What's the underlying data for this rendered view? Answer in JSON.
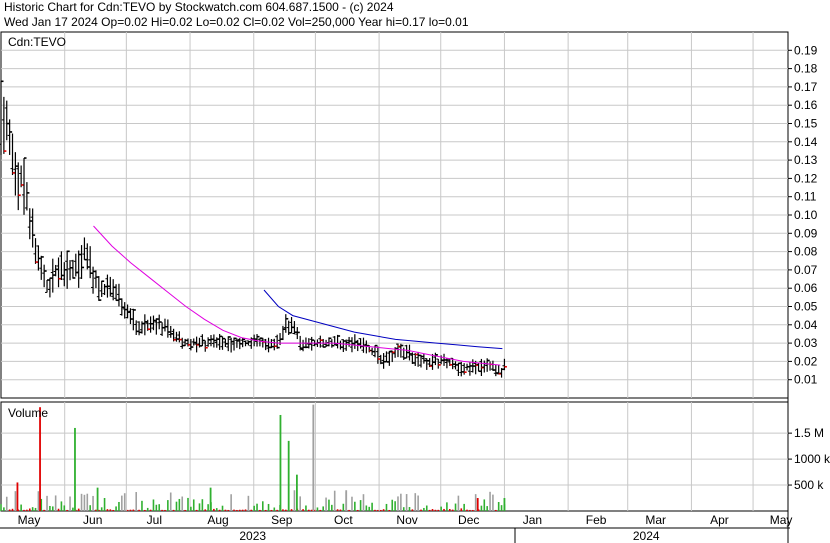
{
  "header": {
    "line1": "Historic Chart for Cdn:TEVO by Stockwatch.com 604.687.1500 - (c) 2024",
    "line2": "Wed Jan 17 2024   Op=0.02  Hi=0.02  Lo=0.02  Cl=0.02  Vol=250,000  Year hi=0.17  lo=0.01"
  },
  "chart_data": {
    "type": "line",
    "symbol_label": "Cdn:TEVO",
    "volume_label": "Volume",
    "price_axis": {
      "range": [
        0,
        0.2
      ],
      "ticks": [
        "0.19",
        "0.18",
        "0.17",
        "0.16",
        "0.15",
        "0.14",
        "0.13",
        "0.12",
        "0.11",
        "0.10",
        "0.09",
        "0.08",
        "0.07",
        "0.06",
        "0.05",
        "0.04",
        "0.03",
        "0.02",
        "0.01"
      ]
    },
    "volume_axis": {
      "range": [
        0,
        2100000
      ],
      "ticks": [
        {
          "label": "1.5 M",
          "value": 1500000
        },
        {
          "label": "1000 k",
          "value": 1000000
        },
        {
          "label": "500 k",
          "value": 500000
        }
      ]
    },
    "x_axis": {
      "range_days": [
        0,
        383
      ],
      "months": [
        {
          "label": "May",
          "day": 0
        },
        {
          "label": "Jun",
          "day": 31
        },
        {
          "label": "Jul",
          "day": 61
        },
        {
          "label": "Aug",
          "day": 92
        },
        {
          "label": "Sep",
          "day": 123
        },
        {
          "label": "Oct",
          "day": 153
        },
        {
          "label": "Nov",
          "day": 184
        },
        {
          "label": "Dec",
          "day": 214
        },
        {
          "label": "Jan",
          "day": 245
        },
        {
          "label": "Feb",
          "day": 276
        },
        {
          "label": "Mar",
          "day": 305
        },
        {
          "label": "Apr",
          "day": 336
        },
        {
          "label": "May",
          "day": 366
        }
      ],
      "years": [
        {
          "label": "2023",
          "from": 0,
          "to": 245
        },
        {
          "label": "2024",
          "from": 245,
          "to": 383
        }
      ]
    },
    "ohlc_anchors": [
      [
        0,
        0.15
      ],
      [
        2,
        0.16
      ],
      [
        4,
        0.14
      ],
      [
        6,
        0.13
      ],
      [
        8,
        0.12
      ],
      [
        10,
        0.12
      ],
      [
        12,
        0.11
      ],
      [
        14,
        0.1
      ],
      [
        17,
        0.08
      ],
      [
        20,
        0.07
      ],
      [
        23,
        0.06
      ],
      [
        26,
        0.07
      ],
      [
        29,
        0.07
      ],
      [
        32,
        0.07
      ],
      [
        35,
        0.07
      ],
      [
        38,
        0.07
      ],
      [
        41,
        0.08
      ],
      [
        44,
        0.07
      ],
      [
        47,
        0.06
      ],
      [
        51,
        0.06
      ],
      [
        55,
        0.06
      ],
      [
        60,
        0.05
      ],
      [
        66,
        0.04
      ],
      [
        72,
        0.04
      ],
      [
        78,
        0.04
      ],
      [
        84,
        0.035
      ],
      [
        90,
        0.03
      ],
      [
        96,
        0.03
      ],
      [
        102,
        0.03
      ],
      [
        108,
        0.03
      ],
      [
        114,
        0.03
      ],
      [
        120,
        0.03
      ],
      [
        126,
        0.03
      ],
      [
        132,
        0.03
      ],
      [
        135,
        0.03
      ],
      [
        138,
        0.04
      ],
      [
        141,
        0.04
      ],
      [
        146,
        0.03
      ],
      [
        152,
        0.03
      ],
      [
        158,
        0.03
      ],
      [
        164,
        0.03
      ],
      [
        170,
        0.03
      ],
      [
        176,
        0.03
      ],
      [
        182,
        0.025
      ],
      [
        186,
        0.02
      ],
      [
        192,
        0.025
      ],
      [
        198,
        0.025
      ],
      [
        204,
        0.02
      ],
      [
        210,
        0.02
      ],
      [
        216,
        0.02
      ],
      [
        222,
        0.017
      ],
      [
        228,
        0.017
      ],
      [
        234,
        0.017
      ],
      [
        238,
        0.017
      ],
      [
        244,
        0.015
      ],
      [
        246,
        0.02
      ]
    ],
    "ma_short": [
      [
        45,
        0.094
      ],
      [
        54,
        0.083
      ],
      [
        63,
        0.074
      ],
      [
        72,
        0.066
      ],
      [
        81,
        0.058
      ],
      [
        90,
        0.05
      ],
      [
        99,
        0.043
      ],
      [
        108,
        0.037
      ],
      [
        117,
        0.033
      ],
      [
        126,
        0.031
      ],
      [
        135,
        0.03
      ],
      [
        144,
        0.03
      ],
      [
        153,
        0.03
      ],
      [
        162,
        0.03
      ],
      [
        171,
        0.029
      ],
      [
        180,
        0.028
      ],
      [
        189,
        0.027
      ],
      [
        198,
        0.026
      ],
      [
        207,
        0.024
      ],
      [
        216,
        0.022
      ],
      [
        225,
        0.02
      ],
      [
        234,
        0.019
      ],
      [
        243,
        0.018
      ]
    ],
    "ma_long": [
      [
        128,
        0.059
      ],
      [
        135,
        0.05
      ],
      [
        142,
        0.045
      ],
      [
        152,
        0.042
      ],
      [
        162,
        0.039
      ],
      [
        172,
        0.036
      ],
      [
        182,
        0.034
      ],
      [
        192,
        0.032
      ],
      [
        202,
        0.031
      ],
      [
        212,
        0.03
      ],
      [
        222,
        0.029
      ],
      [
        232,
        0.028
      ],
      [
        244,
        0.027
      ]
    ],
    "volume_spikes": [
      {
        "day": 19,
        "value": 2000000,
        "color": "red"
      },
      {
        "day": 36,
        "value": 1600000,
        "color": "green"
      },
      {
        "day": 136,
        "value": 1850000,
        "color": "green"
      },
      {
        "day": 140,
        "value": 1350000,
        "color": "green"
      },
      {
        "day": 152,
        "value": 2050000,
        "color": "gray"
      },
      {
        "day": 144,
        "value": 700000,
        "color": "green"
      },
      {
        "day": 8,
        "value": 550000,
        "color": "red"
      },
      {
        "day": 47,
        "value": 450000,
        "color": "green"
      },
      {
        "day": 102,
        "value": 450000,
        "color": "green"
      },
      {
        "day": 168,
        "value": 400000,
        "color": "gray"
      },
      {
        "day": 232,
        "value": 250000,
        "color": "red"
      },
      {
        "day": 245,
        "value": 250000,
        "color": "green"
      }
    ]
  }
}
